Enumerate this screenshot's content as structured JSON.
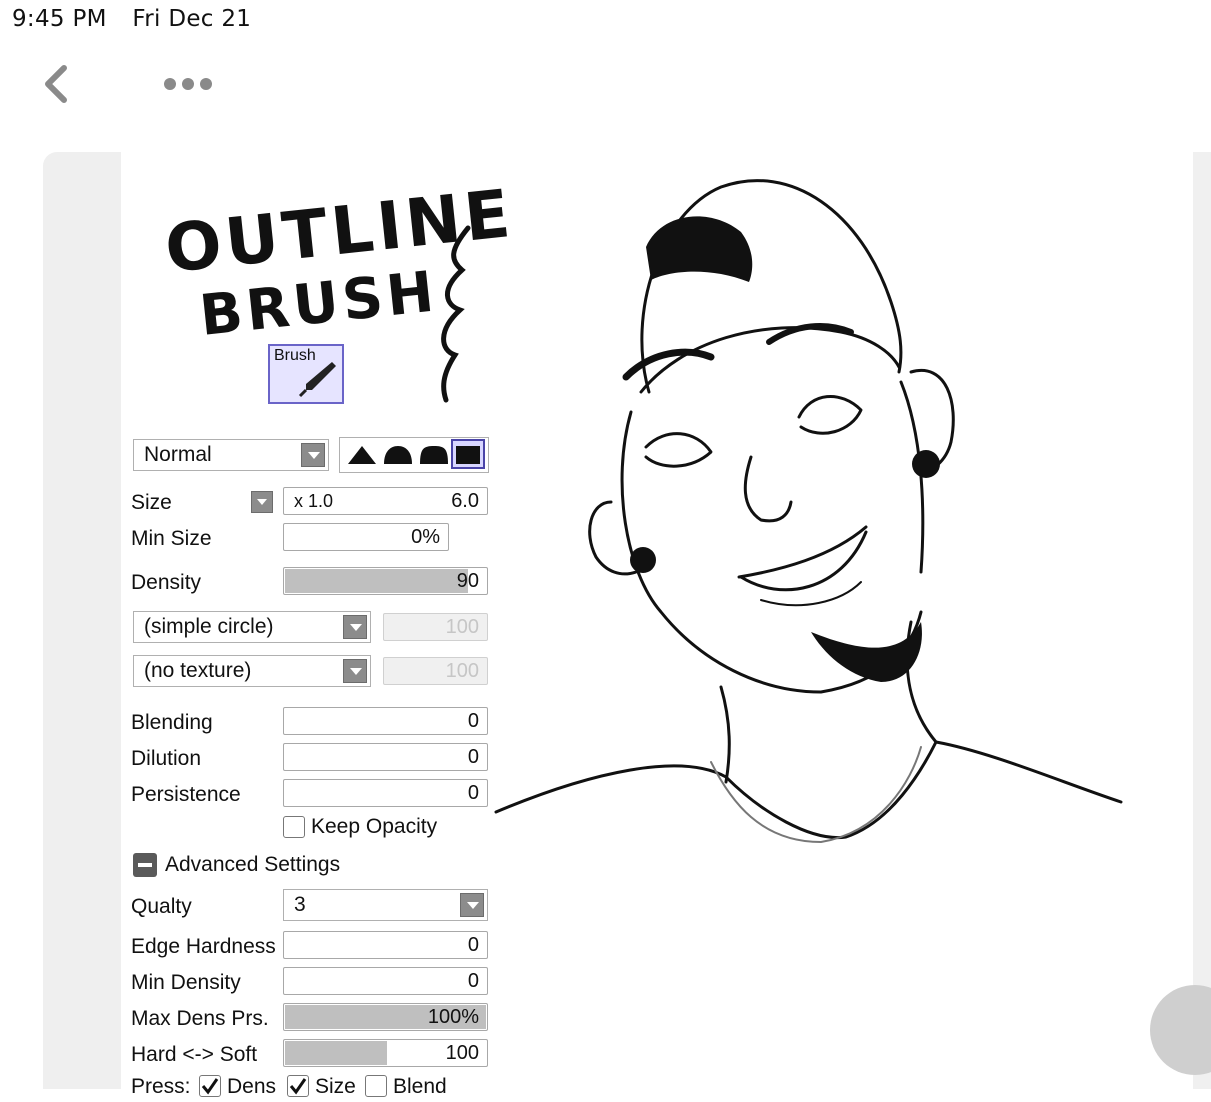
{
  "status_bar": {
    "time": "9:45 PM",
    "date": "Fri Dec 21"
  },
  "nav": {
    "back_icon": "chevron-left-icon",
    "more_icon": "ellipsis-icon"
  },
  "title_art": {
    "line1": "OUTLINE",
    "line2": "BRUSH"
  },
  "brush_tile": {
    "label": "Brush",
    "icon": "brush-pen-icon"
  },
  "panel": {
    "blend_mode": "Normal",
    "shape_options": [
      "sharp",
      "medium",
      "soft",
      "square"
    ],
    "size": {
      "label": "Size",
      "multiplier": "x 1.0",
      "value": "6.0"
    },
    "min_size": {
      "label": "Min Size",
      "value": "0%"
    },
    "density": {
      "label": "Density",
      "value": "90",
      "level": 0.9
    },
    "brush_shape": {
      "value": "(simple circle)",
      "amount": "100"
    },
    "texture": {
      "value": "(no texture)",
      "amount": "100"
    },
    "blending": {
      "label": "Blending",
      "value": "0"
    },
    "dilution": {
      "label": "Dilution",
      "value": "0"
    },
    "persistence": {
      "label": "Persistence",
      "value": "0"
    },
    "keep_opacity": {
      "label": "Keep Opacity",
      "checked": false
    },
    "advanced": {
      "label": "Advanced Settings"
    },
    "quality": {
      "label": "Qualty",
      "value": "3"
    },
    "edge_hardness": {
      "label": "Edge Hardness",
      "value": "0"
    },
    "min_density": {
      "label": "Min Density",
      "value": "0"
    },
    "max_dens_prs": {
      "label": "Max Dens Prs.",
      "value": "100%",
      "level": 1.0
    },
    "hard_soft": {
      "label": "Hard <-> Soft",
      "value": "100",
      "level": 0.5
    },
    "press": {
      "label": "Press:",
      "options": [
        {
          "label": "Dens",
          "checked": true
        },
        {
          "label": "Size",
          "checked": true
        },
        {
          "label": "Blend",
          "checked": false
        }
      ]
    }
  },
  "colors": {
    "tile_bg": "#e6e4ff",
    "tile_border": "#6a64c8",
    "fill_gray": "#bfbfbf"
  }
}
